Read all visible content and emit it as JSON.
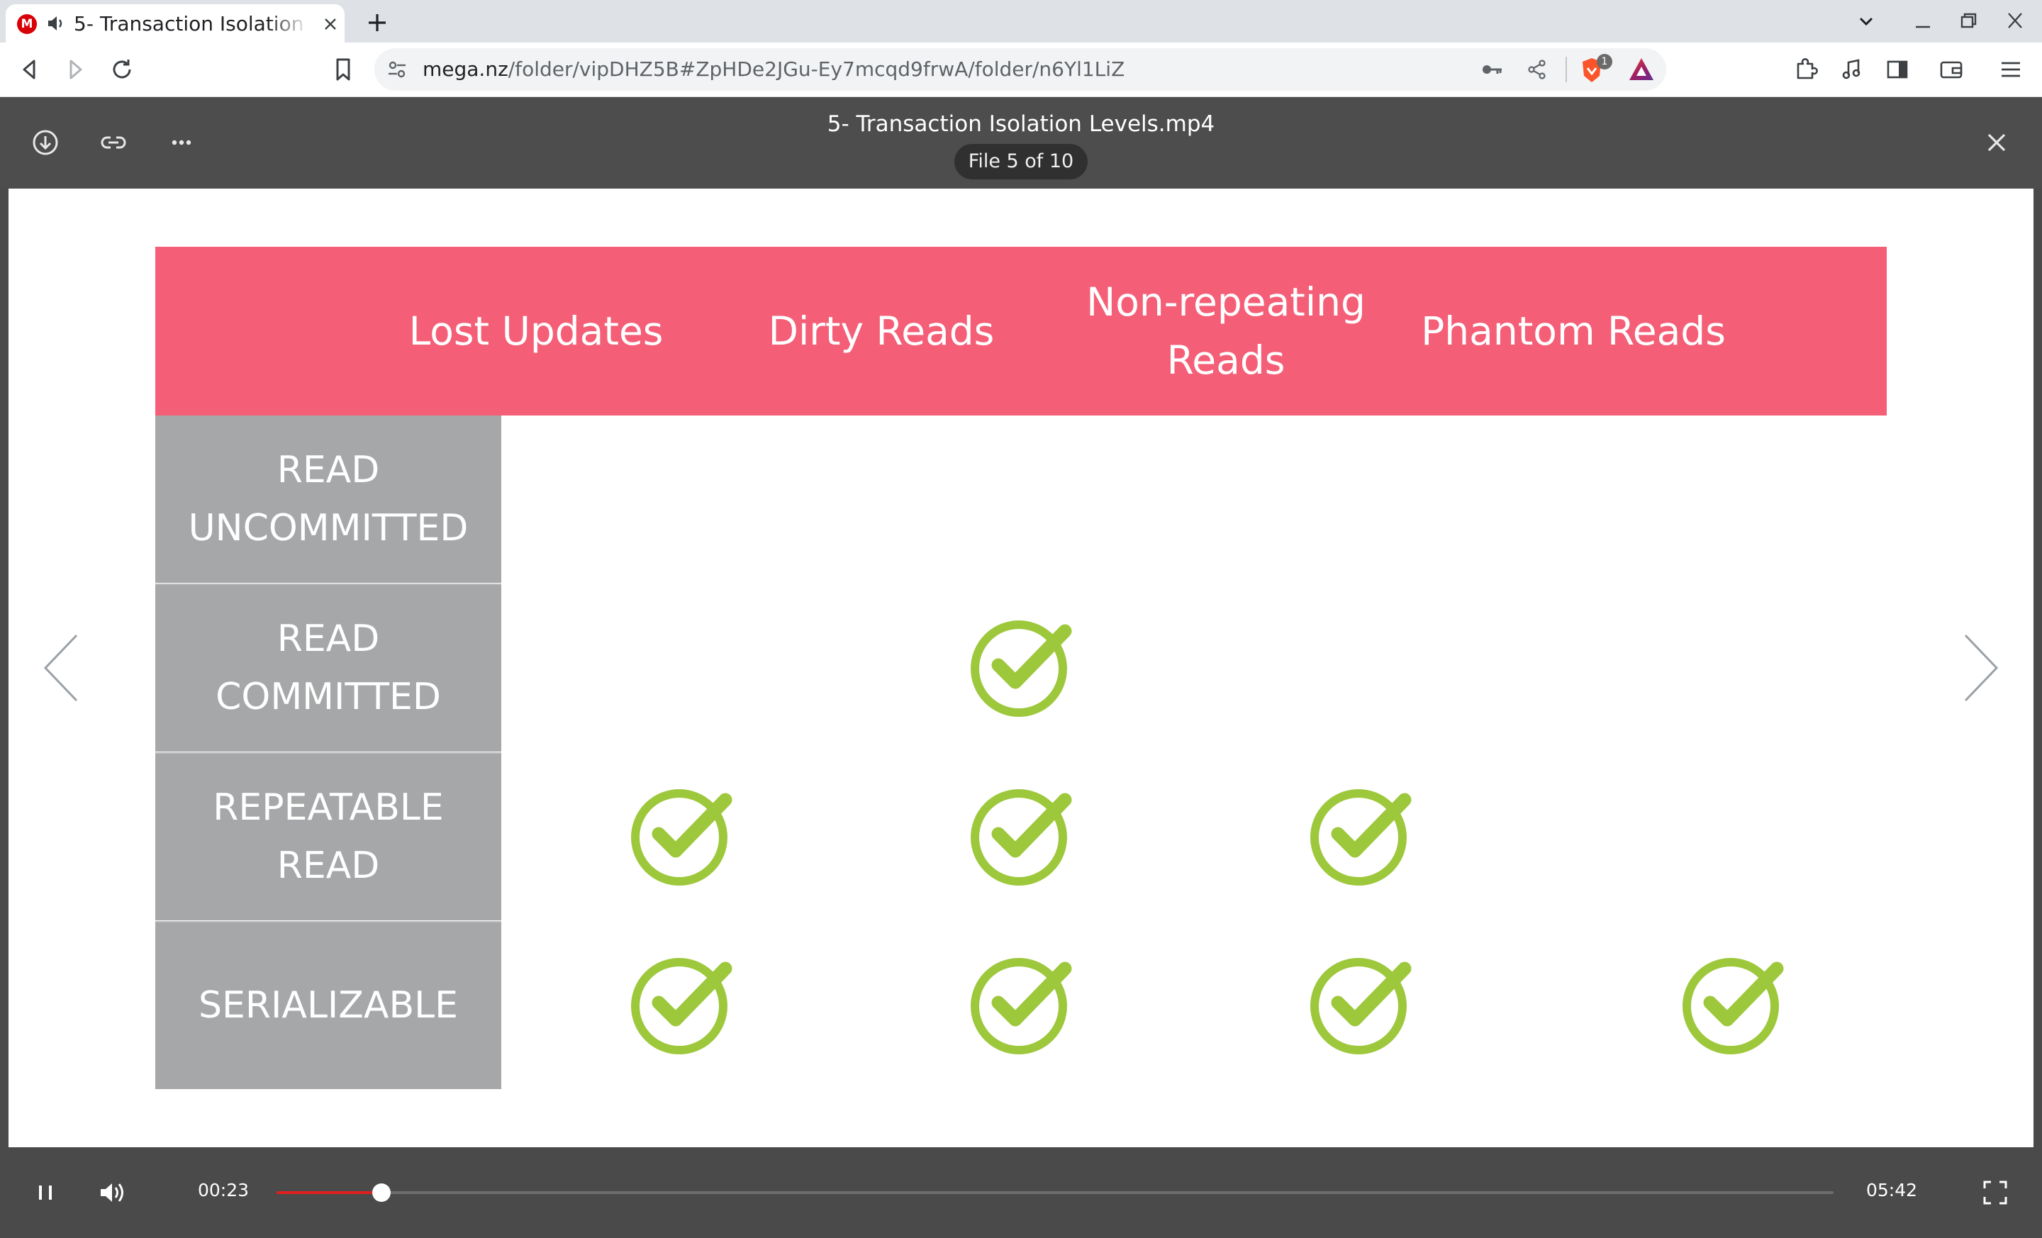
{
  "browser": {
    "tab_title": "5- Transaction Isolation Levels.mp4",
    "tab_favicon_letter": "M",
    "url_host": "mega.nz",
    "url_path": "/folder/vipDHZ5B#ZpHDe2JGu-Ey7mcqd9frwA/folder/n6Yl1LiZ",
    "brave_badge": "1",
    "icons": [
      "close-icon",
      "plus-icon",
      "chevron-down-icon",
      "minimize-icon",
      "restore-icon",
      "back-icon",
      "forward-icon",
      "reload-icon",
      "bookmark-icon",
      "site-info-icon",
      "key-icon",
      "share-icon",
      "brave-shields-icon",
      "brave-rewards-icon",
      "extensions-icon",
      "media-icon",
      "sidebar-icon",
      "wallet-icon",
      "menu-icon"
    ]
  },
  "viewer": {
    "file_name": "5- Transaction Isolation Levels.mp4",
    "file_position": "File 5 of 10",
    "icons": [
      "download-icon",
      "link-icon",
      "more-icon",
      "close-icon",
      "prev-arrow-icon",
      "next-arrow-icon"
    ]
  },
  "slide": {
    "columns": [
      "Lost Updates",
      "Dirty Reads",
      "Non-repeating Reads",
      "Phantom Reads"
    ],
    "column_lines": [
      [
        "Lost Updates"
      ],
      [
        "Dirty Reads"
      ],
      [
        "Non-repeating",
        "Reads"
      ],
      [
        "Phantom Reads"
      ]
    ],
    "rows": [
      {
        "lines": [
          "READ",
          "UNCOMMITTED"
        ],
        "checks": [
          false,
          false,
          false,
          false
        ]
      },
      {
        "lines": [
          "READ",
          "COMMITTED"
        ],
        "checks": [
          false,
          true,
          false,
          false
        ]
      },
      {
        "lines": [
          "REPEATABLE",
          "READ"
        ],
        "checks": [
          true,
          true,
          true,
          false
        ]
      },
      {
        "lines": [
          "SERIALIZABLE"
        ],
        "checks": [
          true,
          true,
          true,
          true
        ]
      }
    ],
    "colors": {
      "header": "#f45f77",
      "row_header": "#a5a7a8",
      "check": "#9dc83b"
    }
  },
  "player": {
    "current_time": "00:23",
    "duration": "05:42",
    "progress_fraction": 0.0672,
    "state": "playing",
    "icons": [
      "pause-icon",
      "volume-icon",
      "fullscreen-icon"
    ]
  }
}
